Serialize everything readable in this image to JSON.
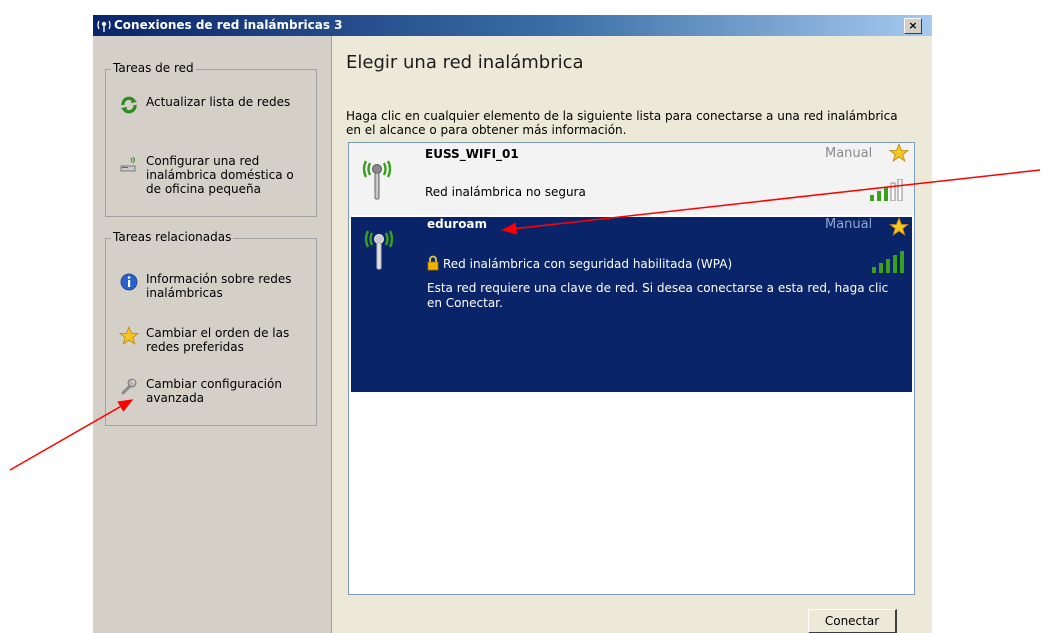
{
  "window": {
    "title": "Conexiones de red inalámbricas 3",
    "close_label": "×"
  },
  "left_pane": {
    "network_tasks": {
      "title": "Tareas de red",
      "items": [
        {
          "label": "Actualizar lista de redes",
          "icon": "refresh-icon"
        },
        {
          "label": "Configurar una red inalámbrica doméstica o de oficina pequeña",
          "icon": "home-network-icon"
        }
      ]
    },
    "related_tasks": {
      "title": "Tareas relacionadas",
      "items": [
        {
          "label": "Información sobre redes inalámbricas",
          "icon": "info-icon"
        },
        {
          "label": "Cambiar el orden de las redes preferidas",
          "icon": "star-icon"
        },
        {
          "label": "Cambiar configuración avanzada",
          "icon": "wrench-icon"
        }
      ]
    }
  },
  "main": {
    "heading": "Elegir una red inalámbrica",
    "description": "Haga clic en cualquier elemento de la siguiente lista para conectarse a una red inalámbrica en el alcance o para obtener más información.",
    "networks": [
      {
        "name": "EUSS_WIFI_01",
        "mode": "Manual",
        "security": "Red inalámbrica no segura",
        "signal_bars": 3
      },
      {
        "name": "eduroam",
        "mode": "Manual",
        "security": "Red inalámbrica con seguridad habilitada (WPA)",
        "message": "Esta red requiere una clave de red. Si desea conectarse a esta red, haga clic en Conectar.",
        "signal_bars": 5,
        "selected": true
      }
    ],
    "connect_label": "Conectar"
  },
  "colors": {
    "selection": "#0a246a",
    "annotation_arrow": "#ff0000",
    "signal_green": "#3aa11e"
  }
}
